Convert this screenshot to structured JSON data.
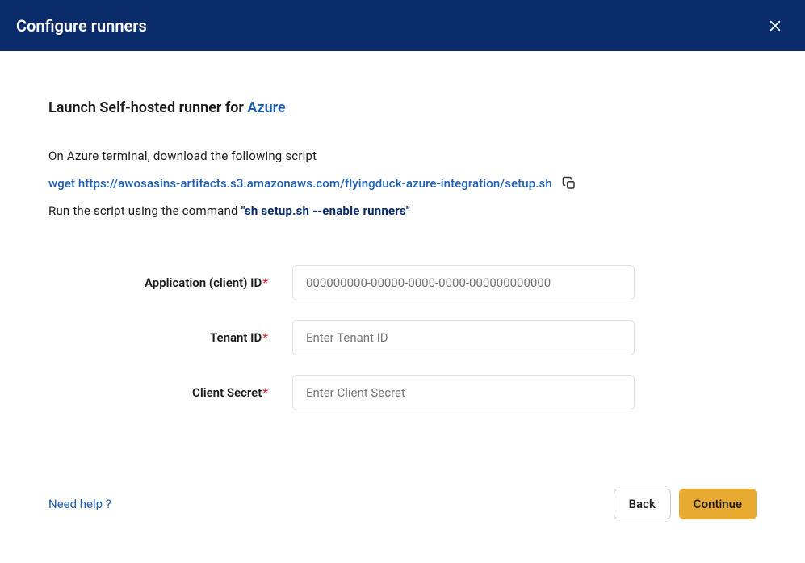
{
  "header": {
    "title": "Configure runners"
  },
  "content": {
    "subtitle_prefix": "Launch Self-hosted runner for ",
    "subtitle_link": "Azure",
    "instruction1": "On Azure terminal, download the following script",
    "script_url": "wget https://awosasins-artifacts.s3.amazonaws.com/flyingduck-azure-integration/setup.sh",
    "run_prefix": "Run the script using the command ",
    "run_command": "\"sh setup.sh --enable runners\""
  },
  "form": {
    "app_id": {
      "label": "Application (client) ID",
      "placeholder": "000000000-00000-0000-0000-000000000000"
    },
    "tenant_id": {
      "label": "Tenant ID",
      "placeholder": "Enter Tenant ID"
    },
    "client_secret": {
      "label": "Client Secret",
      "placeholder": "Enter Client Secret"
    }
  },
  "footer": {
    "help_link": "Need help ?",
    "back_button": "Back",
    "continue_button": "Continue"
  }
}
